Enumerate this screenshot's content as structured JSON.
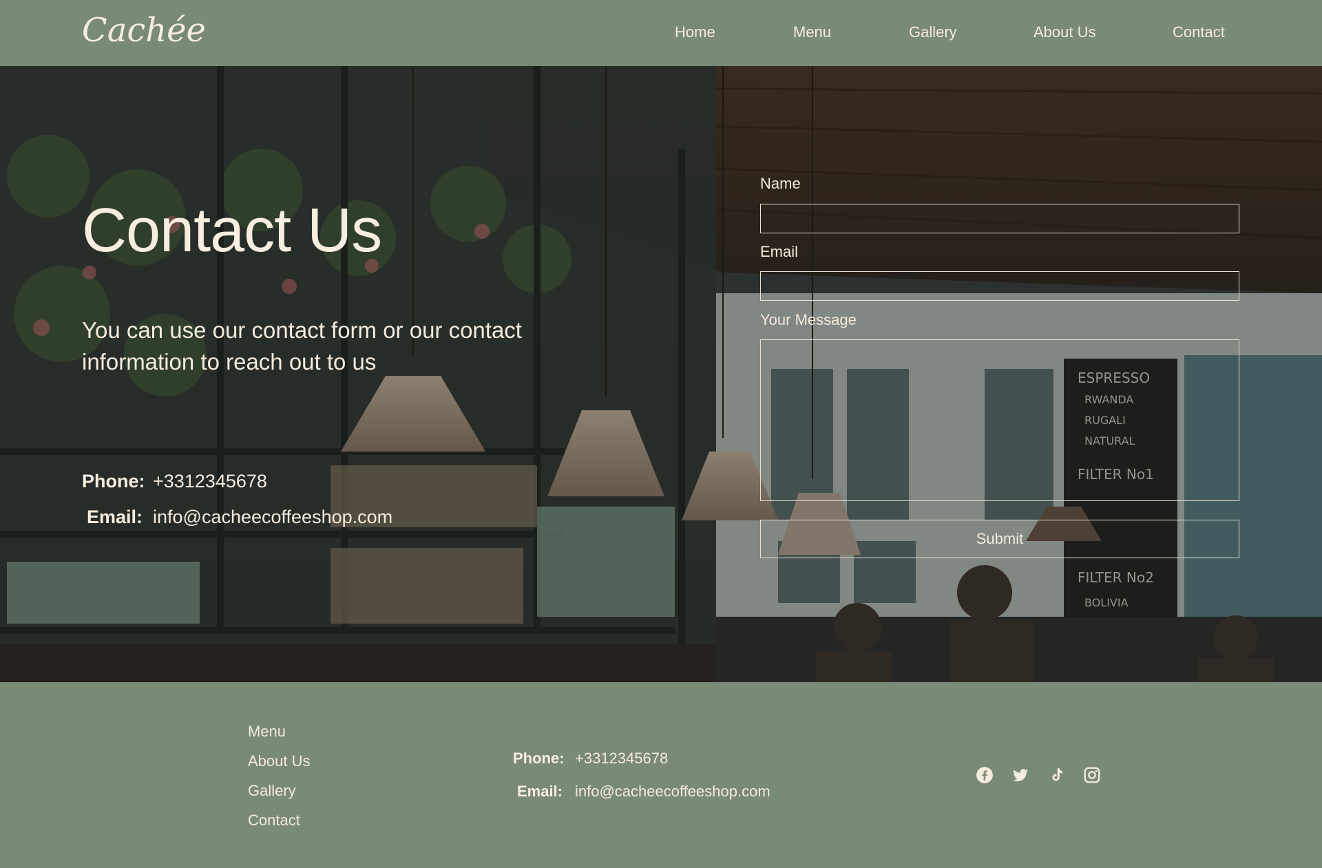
{
  "brand": {
    "logo": "Cachée"
  },
  "nav": {
    "items": [
      {
        "label": "Home"
      },
      {
        "label": "Menu"
      },
      {
        "label": "Gallery"
      },
      {
        "label": "About Us"
      },
      {
        "label": "Contact"
      }
    ]
  },
  "hero": {
    "title": "Contact Us",
    "subtitle": "You can use our contact form or our contact information to reach out to us",
    "phone_label": "Phone:",
    "phone": "+3312345678",
    "email_label": "Email:",
    "email": "info@cacheecoffeeshop.com"
  },
  "form": {
    "name_label": "Name",
    "name_value": "",
    "email_label": "Email",
    "email_value": "",
    "message_label": "Your Message",
    "message_value": "",
    "submit_label": "Submit"
  },
  "footer": {
    "links": [
      {
        "label": "Menu"
      },
      {
        "label": "About Us"
      },
      {
        "label": "Gallery"
      },
      {
        "label": "Contact"
      }
    ],
    "phone_label": "Phone:",
    "phone": "+3312345678",
    "email_label": "Email:",
    "email": "info@cacheecoffeeshop.com",
    "social": [
      "facebook-icon",
      "twitter-icon",
      "tiktok-icon",
      "instagram-icon"
    ]
  },
  "colors": {
    "header_bg": "#798a77",
    "text_cream": "#f4ebdc"
  }
}
